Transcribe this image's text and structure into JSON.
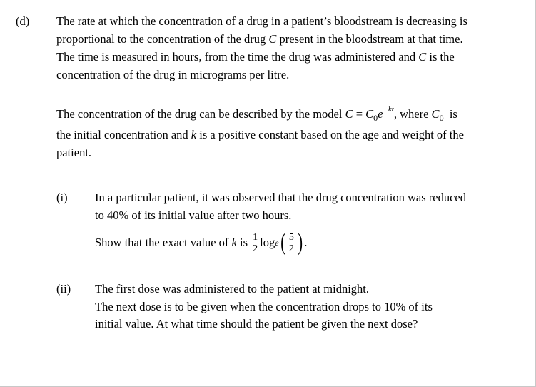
{
  "part_d": {
    "label": "(d)",
    "para1": [
      "The rate at which the concentration of a drug in a patient’s bloodstream is decreasing is",
      "proportional to the concentration of the drug",
      "present in the bloodstream at that time.",
      "The time is measured in hours, from the time the drug was administered and",
      "is the",
      "concentration of the drug in micrograms per litre."
    ],
    "para2": {
      "prefix": "The concentration of the drug can be described by the model",
      "suffix": ", where",
      "suffix2": "is",
      "line2a": "the initial concentration and",
      "line2b": "is a positive constant based on the age and weight of the",
      "line3": "patient."
    },
    "part_i": {
      "label": "(i)",
      "line1": "In a particular patient, it was observed that the drug concentration was reduced",
      "line2": "to 40% of its initial value after two hours.",
      "line3_prefix": "Show that the exact value of",
      "line3_is": "is",
      "log": "log",
      "log_base": "e",
      "frac_outer_num": "1",
      "frac_outer_den": "2",
      "frac_inner_num": "5",
      "frac_inner_den": "2"
    },
    "part_ii": {
      "label": "(ii)",
      "line1": "The first dose was administered to the patient at midnight.",
      "line2": "The next dose is to be given when the concentration drops to 10% of its",
      "line3": "initial value.  At what time should the patient be given the next dose?"
    },
    "symbols": {
      "C": "C",
      "k": "k",
      "C0_base": "C",
      "C0_sub": "0",
      "e": "e",
      "exp": "−kt",
      "eq": "="
    }
  }
}
